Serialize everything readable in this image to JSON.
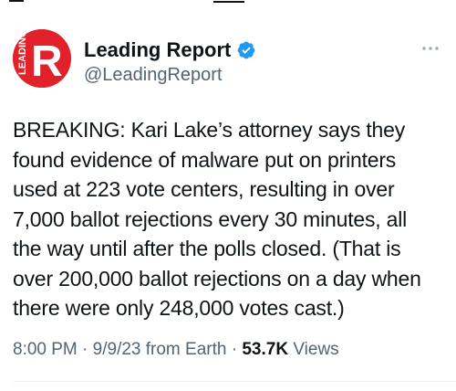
{
  "account": {
    "display_name": "Leading Report",
    "handle": "@LeadingReport",
    "verified": true,
    "avatar": {
      "letter": "R",
      "side_text": "LEADING",
      "color": "#e2222a"
    }
  },
  "tweet": {
    "lines": [
      "BREAKING: Kari Lake’s attorney says they",
      "found evidence of malware put on printers",
      "used at 223 vote centers, resulting in over",
      "7,000 ballot rejections every 30 minutes, all",
      "the way until after the polls closed. (That is",
      "over 200,000 ballot rejections on a day when",
      "there were only 248,000 votes cast.)"
    ]
  },
  "meta": {
    "time": "8:00 PM",
    "sep1": " · ",
    "date": "9/9/23",
    "source": " from Earth",
    "sep2": " · ",
    "views_count": "53.7K",
    "views_label": " Views"
  },
  "icons": {
    "verified": "verified-badge-icon",
    "more": "more-options-icon"
  },
  "colors": {
    "verified_blue": "#1d9bf0",
    "secondary_text": "#536471",
    "primary_text": "#0f1419"
  }
}
